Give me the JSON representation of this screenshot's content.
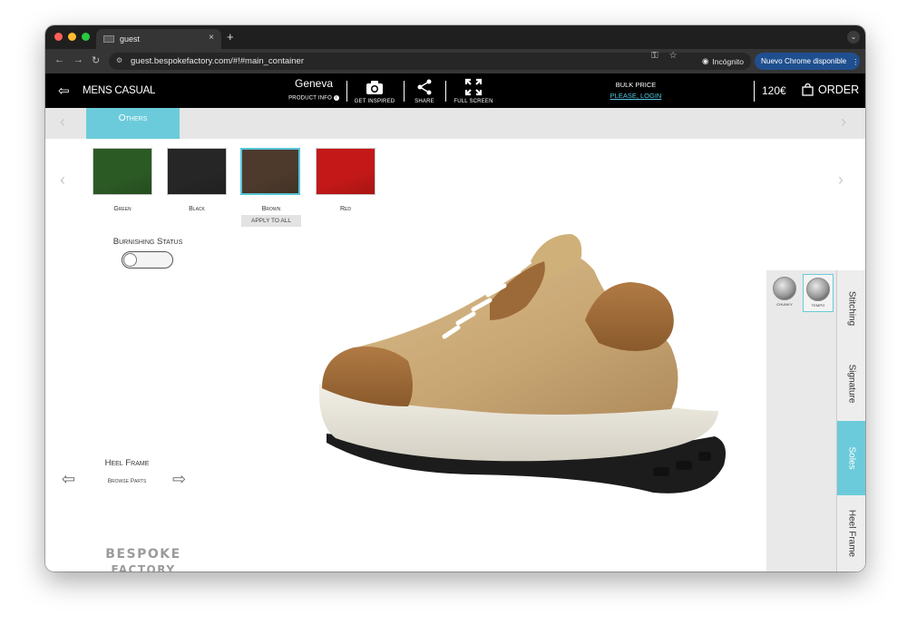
{
  "browser": {
    "tab_title": "guest",
    "tab_close": "×",
    "new_tab": "+",
    "url": "guest.bespokefactory.com/#!#main_container",
    "incognito_label": "Incógnito",
    "update_label": "Nuevo Chrome disponible"
  },
  "header": {
    "collection": "MENS CASUAL",
    "model_name": "Geneva",
    "product_info": "PRODUCT INFO",
    "get_inspired": "GET INSPIRED",
    "share": "SHARE",
    "full_screen": "FULL SCREEN",
    "bulk_price": "BULK PRICE",
    "login": "PLEASE, LOGIN",
    "price": "120€",
    "order": "ORDER"
  },
  "category": {
    "active_tab": "Others"
  },
  "swatches": [
    {
      "label": "Green",
      "color": "#2c5a25",
      "selected": false
    },
    {
      "label": "Black",
      "color": "#262626",
      "selected": false
    },
    {
      "label": "Brown",
      "color": "#4d3a2c",
      "selected": true
    },
    {
      "label": "Red",
      "color": "#c41818",
      "selected": false
    }
  ],
  "apply_to_all": "APPLY TO ALL",
  "burnishing": {
    "label": "Burnishing Status",
    "enabled": false
  },
  "part_browser": {
    "title": "Heel Frame",
    "subtitle": "Browse Parts"
  },
  "logo": {
    "line1": "BESPOKE",
    "line2": "FACTORY"
  },
  "sole_options": [
    {
      "label": "CHUNKY",
      "selected": false
    },
    {
      "label": "TEMPO",
      "selected": true
    }
  ],
  "side_tabs": [
    {
      "label": "Stitching",
      "active": false
    },
    {
      "label": "Signature",
      "active": false
    },
    {
      "label": "Soles",
      "active": true
    },
    {
      "label": "Heel Frame",
      "active": false
    }
  ],
  "colors": {
    "accent": "#6ccbdb",
    "header_bg": "#000000",
    "login_link": "#56c6e0",
    "update_btn": "#1f4f8f"
  }
}
